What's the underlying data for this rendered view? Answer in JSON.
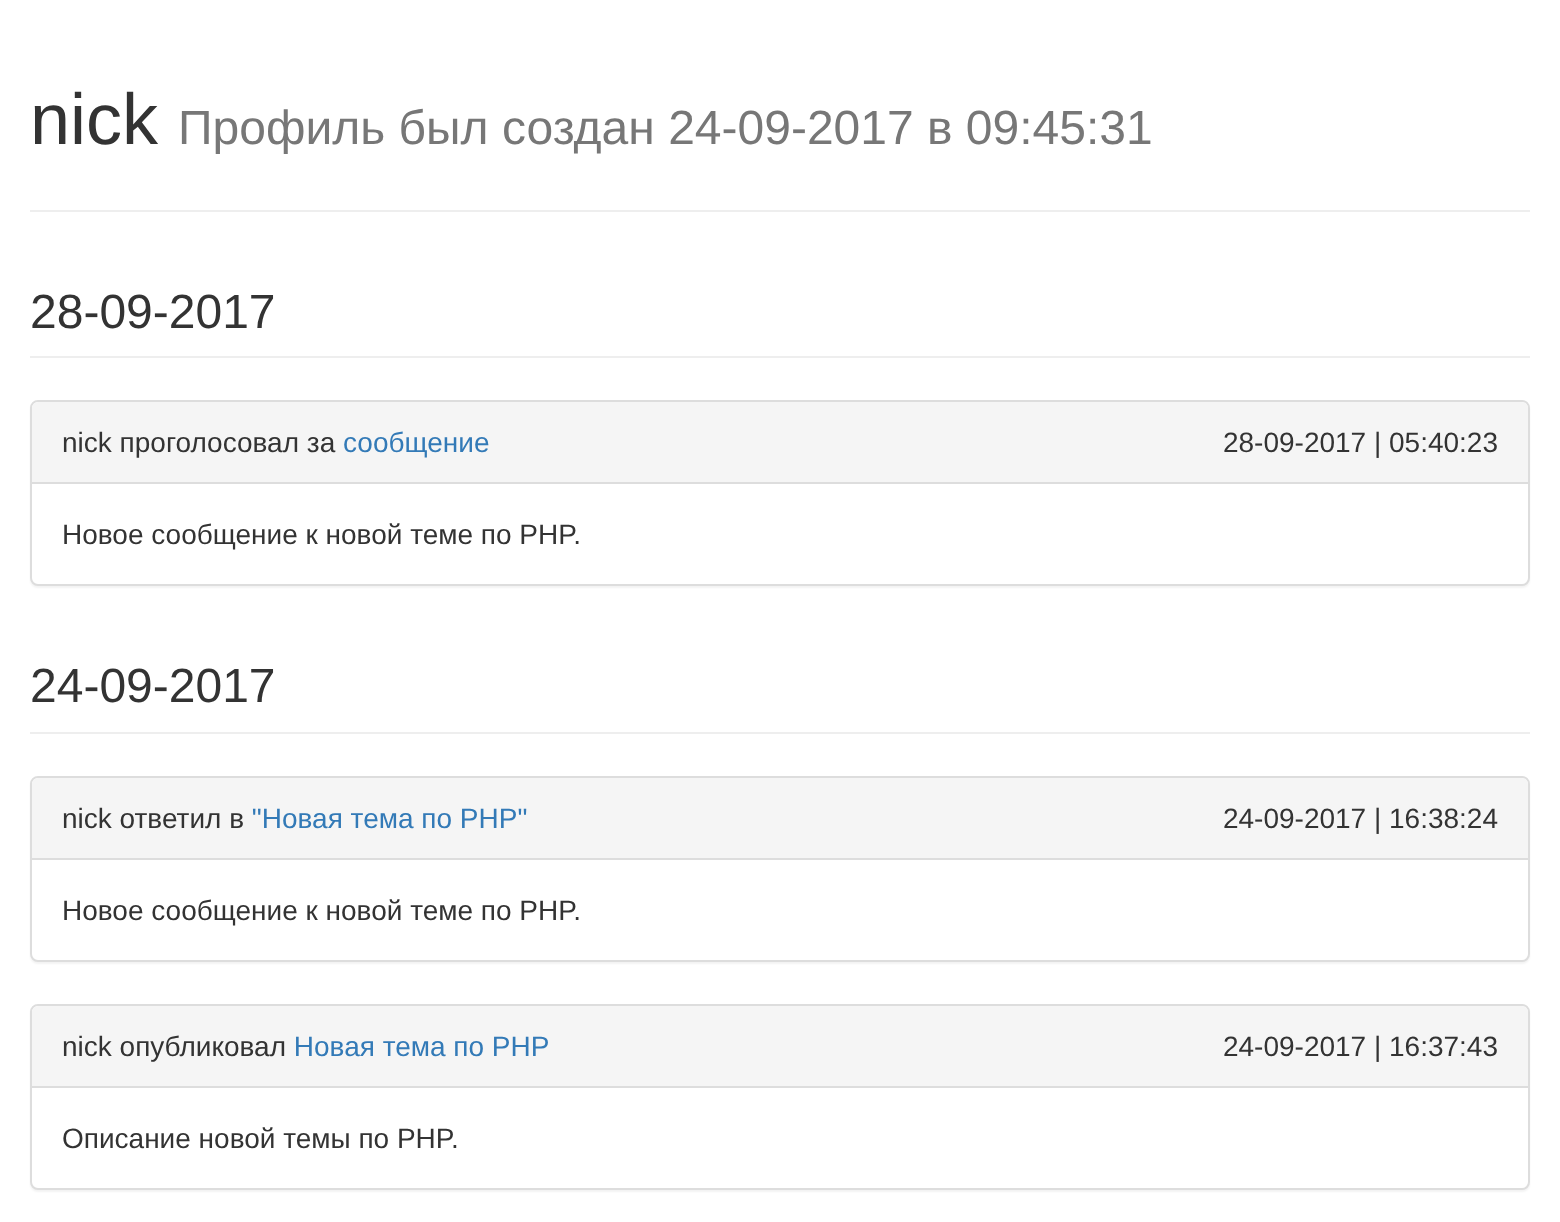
{
  "profile": {
    "username": "nick",
    "created": "Профиль был создан 24-09-2017 в 09:45:31"
  },
  "days": [
    {
      "date": "28-09-2017",
      "events": [
        {
          "text": "nick проголосовал за",
          "link": "сообщение",
          "time": "28-09-2017 | 05:40:23",
          "body": "Новое сообщение к новой теме по PHP."
        }
      ]
    },
    {
      "date": "24-09-2017",
      "events": [
        {
          "text": "nick ответил в",
          "link": "\"Новая тема по PHP\"",
          "time": "24-09-2017 | 16:38:24",
          "body": "Новое сообщение к новой теме по PHP."
        },
        {
          "text": "nick опубликовал",
          "link": "Новая тема по PHP",
          "time": "24-09-2017 | 16:37:43",
          "body": "Описание новой темы по PHP."
        }
      ]
    }
  ]
}
